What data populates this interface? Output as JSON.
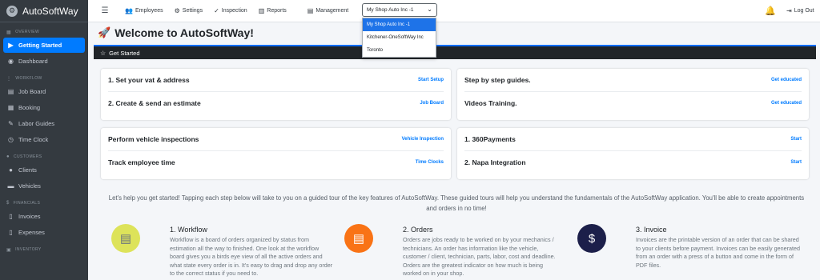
{
  "brand": {
    "name": "AutoSoftWay",
    "logo_icon": "wheel-icon"
  },
  "sidebar": {
    "sections": [
      {
        "header": "OVERVIEW",
        "items": [
          {
            "label": "Getting Started",
            "icon": "play-circle-icon",
            "active": true
          },
          {
            "label": "Dashboard",
            "icon": "tachometer-icon"
          }
        ]
      },
      {
        "header": "WORKFLOW",
        "items": [
          {
            "label": "Job Board",
            "icon": "clipboard-icon"
          },
          {
            "label": "Booking",
            "icon": "calendar-icon"
          },
          {
            "label": "Labor Guides",
            "icon": "wrench-icon"
          },
          {
            "label": "Time Clock",
            "icon": "clock-icon"
          }
        ]
      },
      {
        "header": "CUSTOMERS",
        "items": [
          {
            "label": "Clients",
            "icon": "user-icon"
          },
          {
            "label": "Vehicles",
            "icon": "car-icon"
          }
        ]
      },
      {
        "header": "FINANCIALS",
        "items": [
          {
            "label": "Invoices",
            "icon": "file-icon"
          },
          {
            "label": "Expenses",
            "icon": "receipt-icon"
          }
        ]
      },
      {
        "header": "INVENTORY",
        "items": []
      }
    ]
  },
  "topbar": {
    "employees": "Employees",
    "settings": "Settings",
    "inspection": "Inspection",
    "reports": "Reports",
    "management": "Management",
    "logout": "Log Out"
  },
  "shop_select": {
    "value": "My Shop Auto Inc -1",
    "options": [
      "My Shop Auto Inc -1",
      "Kitchener-OneSoftWay Inc",
      "Toronto"
    ]
  },
  "page": {
    "title": "Welcome to AutoSoftWay!",
    "banner": "Get Started"
  },
  "cards": {
    "setup": [
      {
        "title": "1. Set your vat & address",
        "link": "Start Setup"
      },
      {
        "title": "2. Create & send an estimate",
        "link": "Job Board"
      }
    ],
    "guides": [
      {
        "title": "Step by step guides.",
        "link": "Get educated"
      },
      {
        "title": "Videos Training.",
        "link": "Get educated"
      }
    ],
    "inspections": [
      {
        "title": "Perform vehicle inspections",
        "link": "Vehicle Inspection"
      },
      {
        "title": "Track employee time",
        "link": "Time Clocks"
      }
    ],
    "payments": [
      {
        "title": "1. 360Payments",
        "link": "Start"
      },
      {
        "title": "2. Napa Integration",
        "link": "Start"
      }
    ]
  },
  "intro": "Let's help you get started! Tapping each step below will take to you on a guided tour of the key features of AutoSoftWay. These guided tours will help you understand the fundamentals of the AutoSoftWay application. You'll be able to create appointments and orders in no time!",
  "features": [
    {
      "title": "1.   Workflow",
      "desc": "Workflow is a board of orders organized by status from estimation all the way to finished. One look at the workflow board gives you a birds eye view of all the active orders and what state every order is in. It's easy to drag and drop any order to the correct status if you need to.",
      "color": "#dde35a",
      "icon": "register-icon"
    },
    {
      "title": "2.   Orders",
      "desc": "Orders are jobs ready to be worked on by your mechanics / technicians. An order has information like the vehicle, customer / client, technician, parts, labor, cost and deadline. Orders are the greatest indicator on how much is being worked on in your shop.",
      "color": "#f97316",
      "icon": "document-icon"
    },
    {
      "title": "3.   Invoice",
      "desc": "Invoices are the printable version of an order that can be shared to your clients before payment. Invoices can be easily generated from an order with a press of a button and come in the form of PDF files.",
      "color": "#1c1f4a",
      "icon": "invoice-icon"
    }
  ]
}
